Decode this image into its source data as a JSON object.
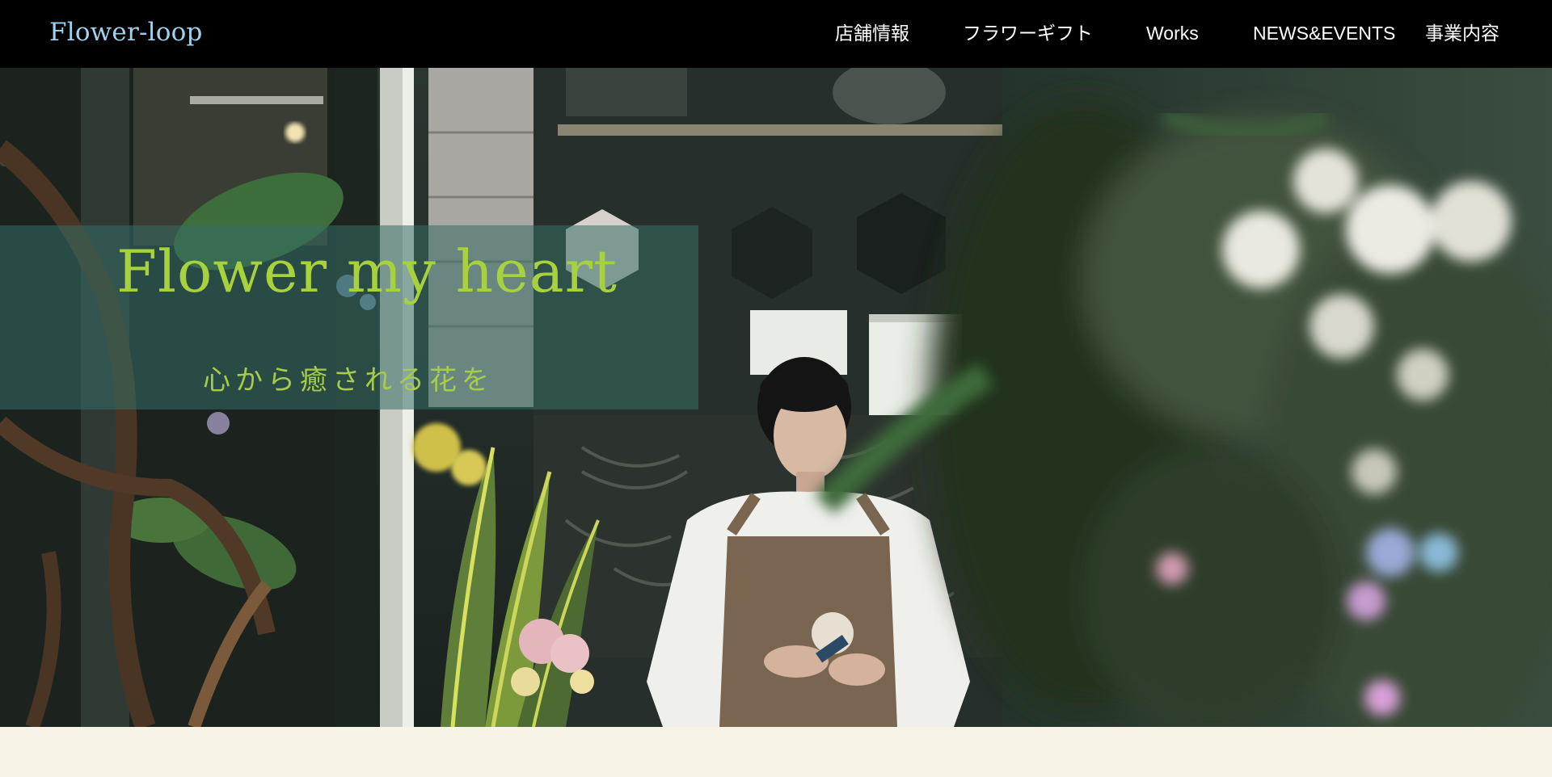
{
  "header": {
    "logo": "Flower-loop",
    "nav": [
      {
        "label": "店舗情報"
      },
      {
        "label": "フラワーギフト"
      },
      {
        "label": "Works"
      },
      {
        "label": "NEWS&EVENTS"
      },
      {
        "label": "事業内容"
      }
    ]
  },
  "hero": {
    "title": "Flower my heart",
    "subtitle": "心から癒される花を"
  },
  "colors": {
    "header_bg": "#000000",
    "logo": "#9fd2ee",
    "nav_text": "#ffffff",
    "hero_title": "#a7d23d",
    "overlay_box": "#346e64",
    "content_bg": "#f8f3e7"
  }
}
